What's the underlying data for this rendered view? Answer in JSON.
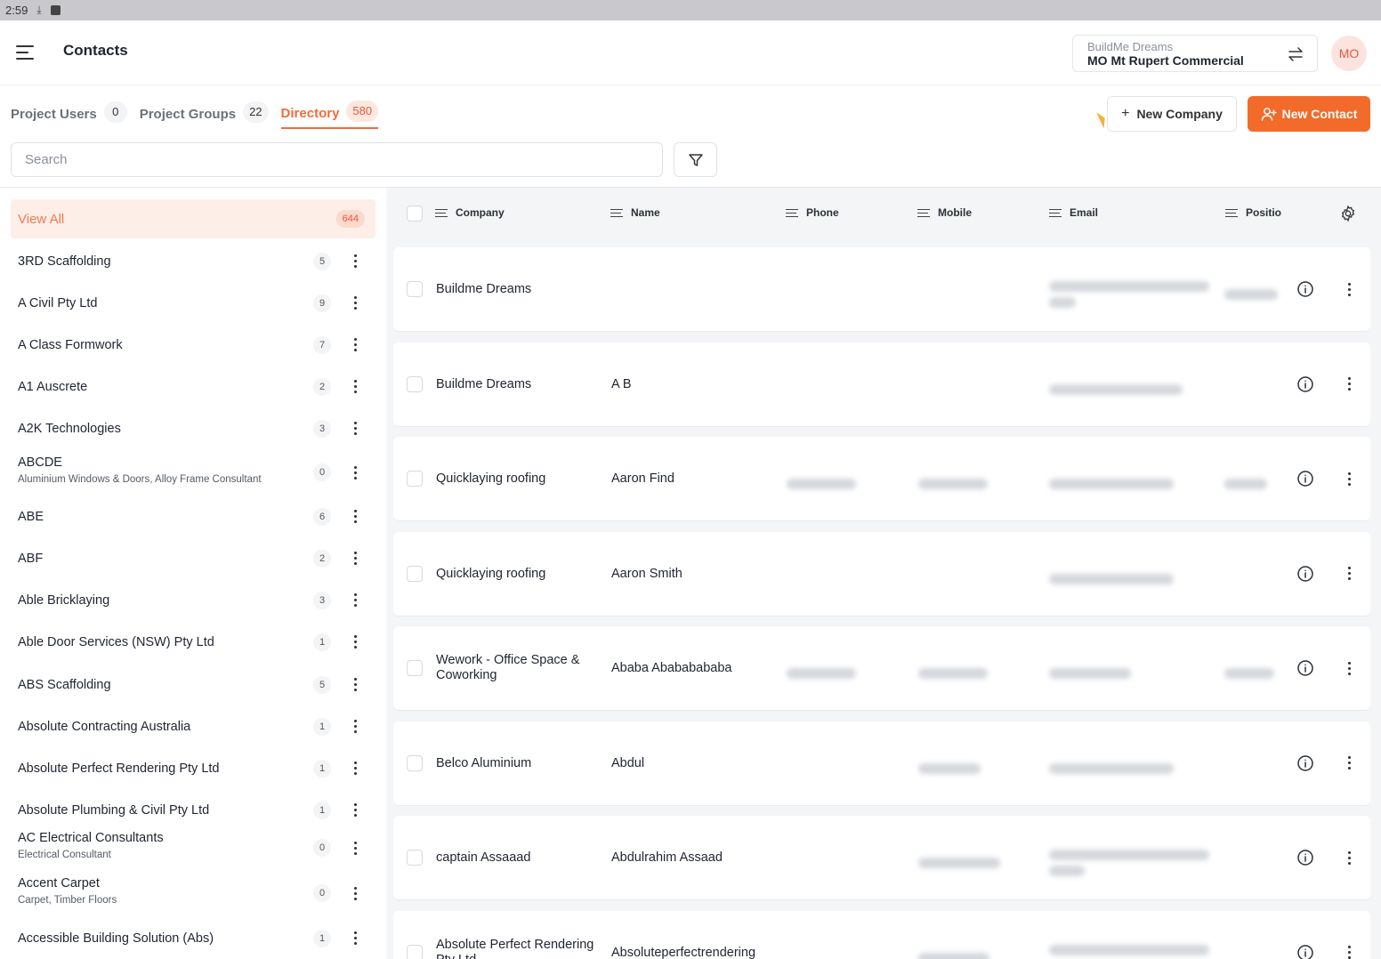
{
  "status_bar": {
    "time": "2:59"
  },
  "header": {
    "title": "Contacts",
    "project_org": "BuildMe Dreams",
    "project_name": "MO Mt Rupert Commercial",
    "avatar_initials": "MO"
  },
  "tabs": [
    {
      "label": "Project Users",
      "count": "0"
    },
    {
      "label": "Project Groups",
      "count": "22"
    },
    {
      "label": "Directory",
      "count": "580",
      "active": true
    }
  ],
  "actions": {
    "new_company": "New Company",
    "new_contact": "New Contact"
  },
  "search": {
    "placeholder": "Search"
  },
  "sidebar": {
    "view_all": {
      "label": "View All",
      "count": "644"
    },
    "companies": [
      {
        "name": "3RD Scaffolding",
        "sub": "",
        "count": "5"
      },
      {
        "name": "A Civil Pty Ltd",
        "sub": "",
        "count": "9"
      },
      {
        "name": "A Class Formwork",
        "sub": "",
        "count": "7"
      },
      {
        "name": "A1 Auscrete",
        "sub": "",
        "count": "2"
      },
      {
        "name": "A2K Technologies",
        "sub": "",
        "count": "3"
      },
      {
        "name": "ABCDE",
        "sub": "Aluminium Windows & Doors, Alloy Frame Consultant",
        "count": "0"
      },
      {
        "name": "ABE",
        "sub": "",
        "count": "6"
      },
      {
        "name": "ABF",
        "sub": "",
        "count": "2"
      },
      {
        "name": "Able Bricklaying",
        "sub": "",
        "count": "3"
      },
      {
        "name": "Able Door Services (NSW) Pty Ltd",
        "sub": "",
        "count": "1"
      },
      {
        "name": "ABS Scaffolding",
        "sub": "",
        "count": "5"
      },
      {
        "name": "Absolute Contracting Australia",
        "sub": "",
        "count": "1"
      },
      {
        "name": "Absolute Perfect Rendering Pty Ltd",
        "sub": "",
        "count": "1"
      },
      {
        "name": "Absolute Plumbing & Civil Pty Ltd",
        "sub": "",
        "count": "1"
      },
      {
        "name": "AC Electrical Consultants",
        "sub": "Electrical Consultant",
        "count": "0"
      },
      {
        "name": "Accent Carpet",
        "sub": "Carpet, Timber Floors",
        "count": "0"
      },
      {
        "name": "Accessible Building Solution (Abs)",
        "sub": "",
        "count": "1"
      }
    ]
  },
  "table": {
    "columns": [
      "Company",
      "Name",
      "Phone",
      "Mobile",
      "Email",
      "Positio"
    ],
    "rows": [
      {
        "company": "Buildme Dreams",
        "name": ""
      },
      {
        "company": "Buildme Dreams",
        "name": "A B"
      },
      {
        "company": "Quicklaying roofing",
        "name": "Aaron Find"
      },
      {
        "company": "Quicklaying roofing",
        "name": "Aaron Smith"
      },
      {
        "company": "Wework - Office Space & Coworking",
        "name": "Ababa Abababababa"
      },
      {
        "company": "Belco Aluminium",
        "name": "Abdul"
      },
      {
        "company": "captain Assaaad",
        "name": "Abdulrahim Assaad"
      },
      {
        "company": "Absolute Perfect Rendering Pty Ltd",
        "name": "Absoluteperfectrendering"
      }
    ]
  },
  "icons": [
    "hamburger-icon",
    "swap-icon",
    "plus-icon",
    "user-plus-icon",
    "filter-icon",
    "settings-gear-icon",
    "info-icon",
    "more-vertical-icon",
    "download-icon"
  ],
  "colors": {
    "accent": "#f26b2a",
    "accent_soft": "#fdeee8"
  }
}
